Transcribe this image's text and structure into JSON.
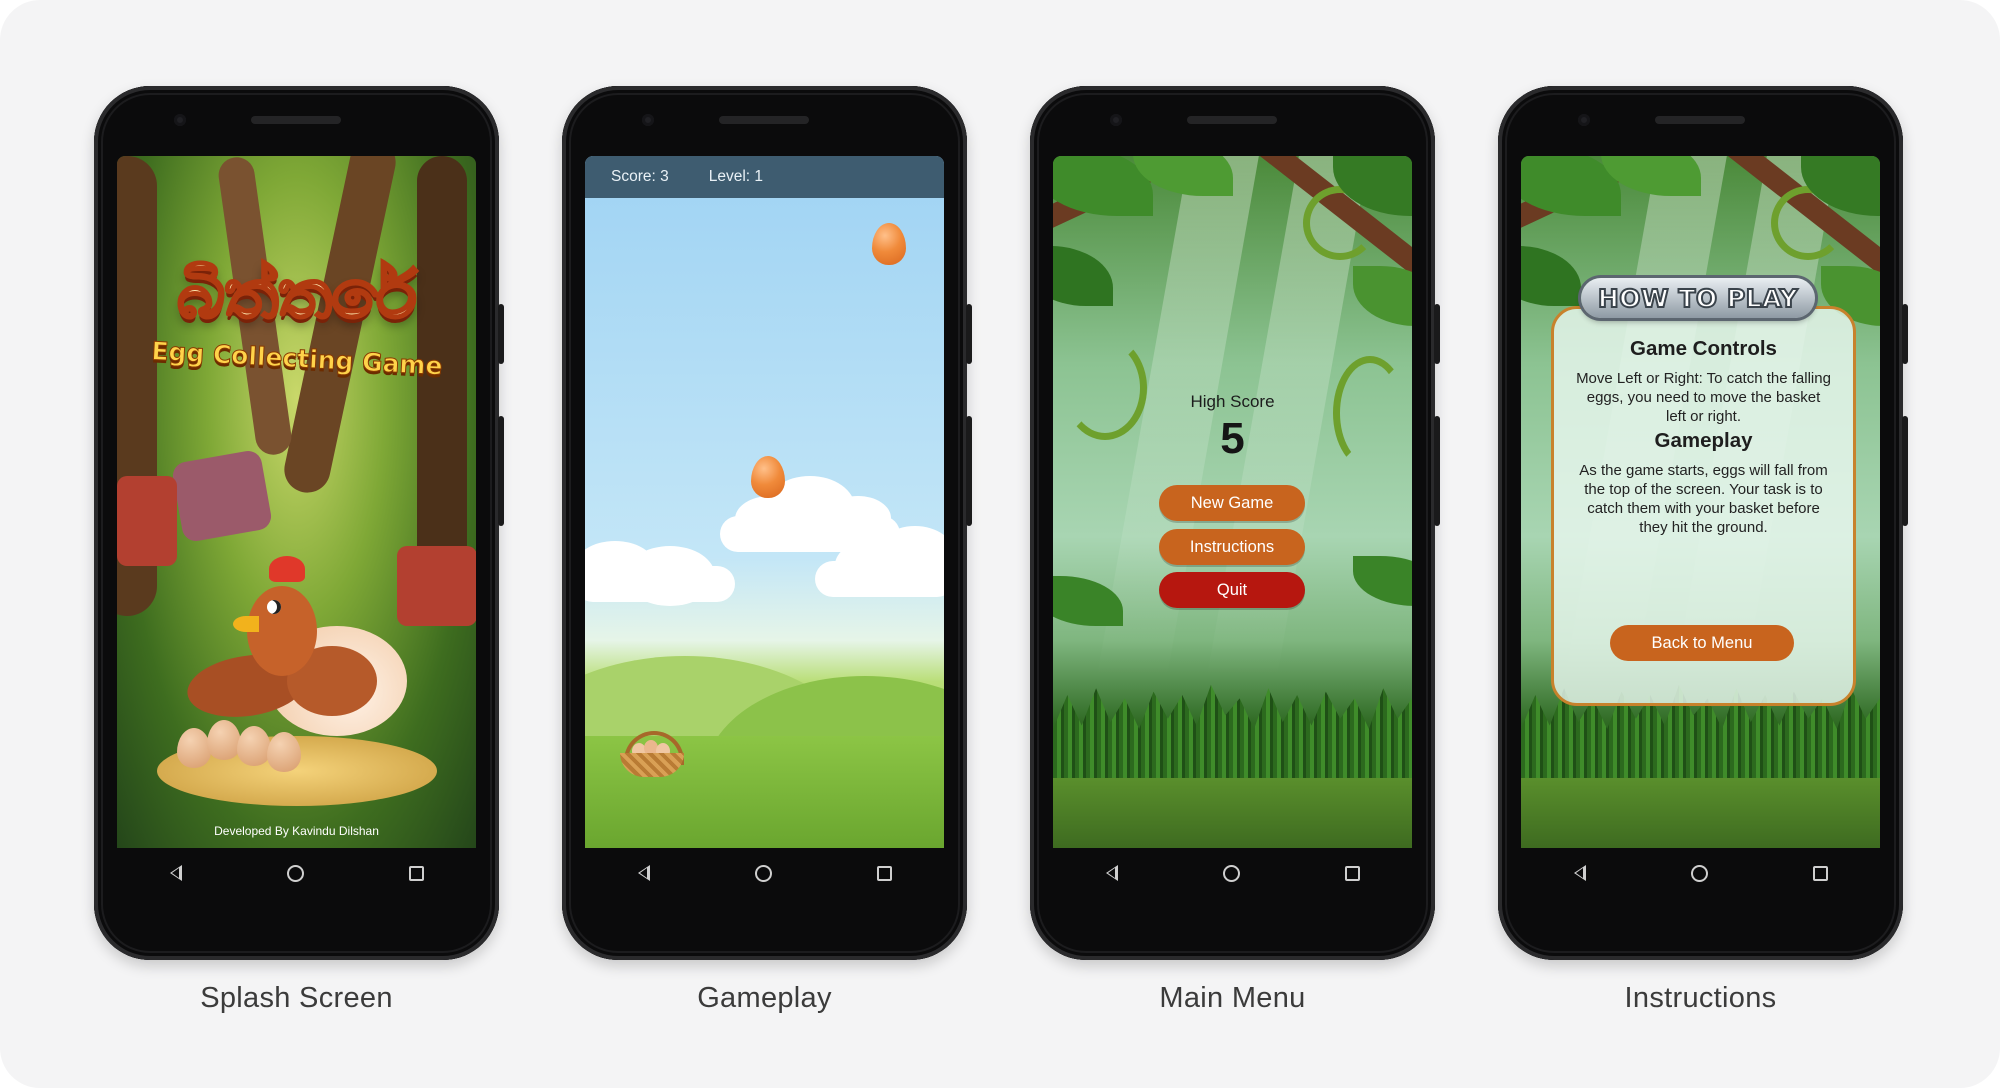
{
  "screens": [
    {
      "caption": "Splash Screen"
    },
    {
      "caption": "Gameplay"
    },
    {
      "caption": "Main Menu"
    },
    {
      "caption": "Instructions"
    }
  ],
  "splash": {
    "title": "බිත්තරේ",
    "subtitle": "Egg Collecting Game",
    "credit": "Developed By Kavindu Dilshan"
  },
  "gameplay": {
    "score_text": "Score: 3",
    "level_text": "Level: 1"
  },
  "menu": {
    "high_score_label": "High Score",
    "high_score_value": "5",
    "new_game": "New Game",
    "instructions": "Instructions",
    "quit": "Quit"
  },
  "instructions": {
    "banner": "HOW TO PLAY",
    "controls_title": "Game Controls",
    "controls_text": "Move Left or Right: To catch the falling eggs, you need to move the basket left or right.",
    "gameplay_title": "Gameplay",
    "gameplay_text": "As the game starts, eggs will fall from the top of the screen. Your task is to catch them with your basket before they hit the ground.",
    "back_button": "Back to Menu"
  },
  "colors": {
    "accent_orange": "#c8641e",
    "quit_red": "#b6170f",
    "hud_bar": "#3e5c70"
  },
  "icons": [
    "nav-back-icon",
    "nav-home-icon",
    "nav-recent-icon",
    "egg-icon",
    "basket-icon",
    "hen-illustration"
  ]
}
